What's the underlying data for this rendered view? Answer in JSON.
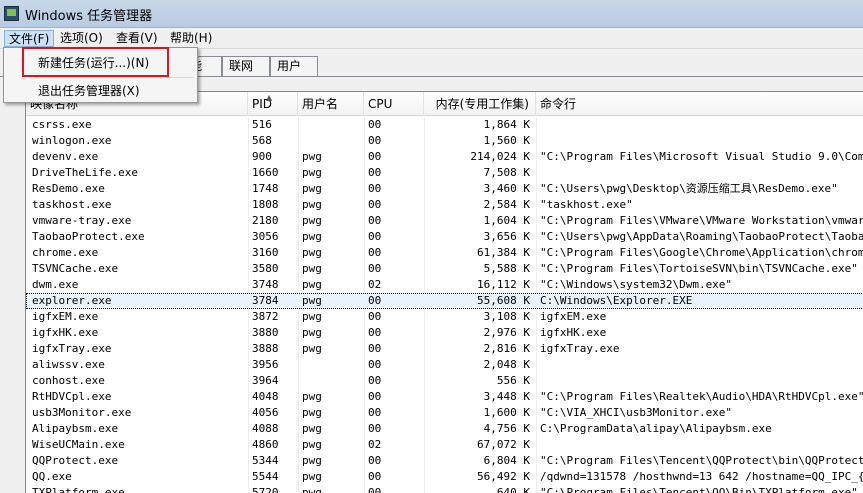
{
  "window": {
    "title": "Windows 任务管理器"
  },
  "menu": [
    "文件(F)",
    "选项(O)",
    "查看(V)",
    "帮助(H)"
  ],
  "tabs": [
    "能",
    "联网",
    "用户"
  ],
  "file_menu": {
    "new_task": "新建任务(运行...)(N)",
    "exit": "退出任务管理器(X)"
  },
  "columns": {
    "image": "映像名称",
    "pid": "PID",
    "user": "用户名",
    "cpu": "CPU",
    "memory": "内存(专用工作集)",
    "command": "命令行"
  },
  "rows": [
    {
      "image": "csrss.exe",
      "pid": "516",
      "user": "",
      "cpu": "00",
      "mem": "1,864 K",
      "cmd": ""
    },
    {
      "image": "winlogon.exe",
      "pid": "568",
      "user": "",
      "cpu": "00",
      "mem": "1,560 K",
      "cmd": ""
    },
    {
      "image": "devenv.exe",
      "pid": "900",
      "user": "pwg",
      "cpu": "00",
      "mem": "214,024 K",
      "cmd": "\"C:\\Program Files\\Microsoft Visual Studio 9.0\\Common7\\"
    },
    {
      "image": "DriveTheLife.exe",
      "pid": "1660",
      "user": "pwg",
      "cpu": "00",
      "mem": "7,508 K",
      "cmd": ""
    },
    {
      "image": "ResDemo.exe",
      "pid": "1748",
      "user": "pwg",
      "cpu": "00",
      "mem": "3,460 K",
      "cmd": "\"C:\\Users\\pwg\\Desktop\\资源压缩工具\\ResDemo.exe\""
    },
    {
      "image": "taskhost.exe",
      "pid": "1808",
      "user": "pwg",
      "cpu": "00",
      "mem": "2,584 K",
      "cmd": "\"taskhost.exe\""
    },
    {
      "image": "vmware-tray.exe",
      "pid": "2180",
      "user": "pwg",
      "cpu": "00",
      "mem": "1,604 K",
      "cmd": "\"C:\\Program Files\\VMware\\VMware Workstation\\vmware-tra"
    },
    {
      "image": "TaobaoProtect.exe",
      "pid": "3056",
      "user": "pwg",
      "cpu": "00",
      "mem": "3,656 K",
      "cmd": "\"C:\\Users\\pwg\\AppData\\Roaming\\TaobaoProtect\\TaobaoProt"
    },
    {
      "image": "chrome.exe",
      "pid": "3160",
      "user": "pwg",
      "cpu": "00",
      "mem": "61,384 K",
      "cmd": "\"C:\\Program Files\\Google\\Chrome\\Application\\chrome.exe"
    },
    {
      "image": "TSVNCache.exe",
      "pid": "3580",
      "user": "pwg",
      "cpu": "00",
      "mem": "5,588 K",
      "cmd": "\"C:\\Program Files\\TortoiseSVN\\bin\\TSVNCache.exe\""
    },
    {
      "image": "dwm.exe",
      "pid": "3748",
      "user": "pwg",
      "cpu": "02",
      "mem": "16,112 K",
      "cmd": "\"C:\\Windows\\system32\\Dwm.exe\""
    },
    {
      "image": "explorer.exe",
      "pid": "3784",
      "user": "pwg",
      "cpu": "00",
      "mem": "55,608 K",
      "cmd": "C:\\Windows\\Explorer.EXE"
    },
    {
      "image": "igfxEM.exe",
      "pid": "3872",
      "user": "pwg",
      "cpu": "00",
      "mem": "3,108 K",
      "cmd": "igfxEM.exe"
    },
    {
      "image": "igfxHK.exe",
      "pid": "3880",
      "user": "pwg",
      "cpu": "00",
      "mem": "2,976 K",
      "cmd": "igfxHK.exe"
    },
    {
      "image": "igfxTray.exe",
      "pid": "3888",
      "user": "pwg",
      "cpu": "00",
      "mem": "2,816 K",
      "cmd": "igfxTray.exe"
    },
    {
      "image": "aliwssv.exe",
      "pid": "3956",
      "user": "",
      "cpu": "00",
      "mem": "2,048 K",
      "cmd": ""
    },
    {
      "image": "conhost.exe",
      "pid": "3964",
      "user": "",
      "cpu": "00",
      "mem": "556 K",
      "cmd": ""
    },
    {
      "image": "RtHDVCpl.exe",
      "pid": "4048",
      "user": "pwg",
      "cpu": "00",
      "mem": "3,448 K",
      "cmd": "\"C:\\Program Files\\Realtek\\Audio\\HDA\\RtHDVCpl.exe\" -s"
    },
    {
      "image": "usb3Monitor.exe",
      "pid": "4056",
      "user": "pwg",
      "cpu": "00",
      "mem": "1,600 K",
      "cmd": "\"C:\\VIA_XHCI\\usb3Monitor.exe\""
    },
    {
      "image": "Alipaybsm.exe",
      "pid": "4088",
      "user": "pwg",
      "cpu": "00",
      "mem": "4,756 K",
      "cmd": "C:\\ProgramData\\alipay\\Alipaybsm.exe"
    },
    {
      "image": "WiseUCMain.exe",
      "pid": "4860",
      "user": "pwg",
      "cpu": "02",
      "mem": "67,072 K",
      "cmd": ""
    },
    {
      "image": "QQProtect.exe",
      "pid": "5344",
      "user": "pwg",
      "cpu": "00",
      "mem": "6,804 K",
      "cmd": "\"C:\\Program Files\\Tencent\\QQProtect\\bin\\QQProtect.e"
    },
    {
      "image": "QQ.exe",
      "pid": "5544",
      "user": "pwg",
      "cpu": "00",
      "mem": "56,492 K",
      "cmd": "/qdwnd=131578 /hosthwnd=13 642 /hostname=QQ_IPC_{4549"
    },
    {
      "image": "TXPlatform.exe",
      "pid": "5720",
      "user": "pwg",
      "cpu": "00",
      "mem": "640 K",
      "cmd": "\"C:\\Program Files\\Tencent\\QQ\\Bin\\TXPlatform.exe\" -Emb"
    }
  ]
}
